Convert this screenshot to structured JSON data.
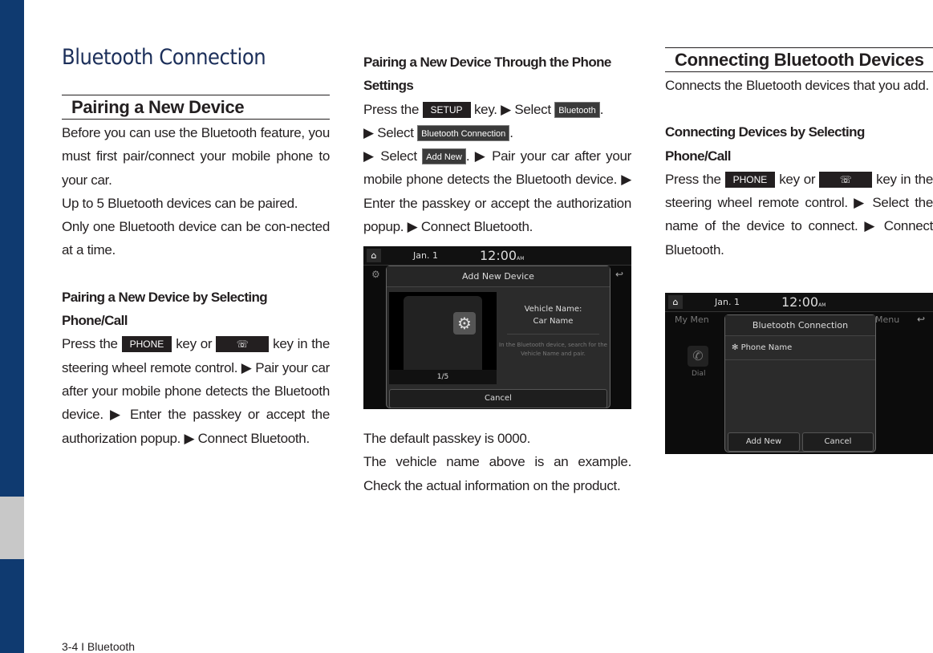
{
  "page_title": "Bluetooth Connection",
  "footer": "3-4 I Bluetooth",
  "colors": {
    "sidebar": "#0f3a70",
    "sidebar_tab": "#c8c8c8",
    "title": "#1c2f5a"
  },
  "col1": {
    "section": "Pairing a New Device",
    "blocks": [
      {
        "p": [
          {
            "t": "Before you can use the Bluetooth feature, you must first pair/connect your mobile phone to your car."
          }
        ]
      },
      {
        "p": [
          {
            "t": "Up to 5 Bluetooth devices can be paired."
          }
        ]
      },
      {
        "p": [
          {
            "t": "Only one Bluetooth device can be con-nected at a time."
          }
        ]
      },
      {
        "gap": true
      },
      {
        "sub": "Pairing a New Device by Selecting Phone/Call"
      },
      {
        "p": [
          {
            "t": "Press the "
          },
          {
            "key": "PHONE"
          },
          {
            "t": " key or "
          },
          {
            "icon": "phone-call-icon"
          },
          {
            "t": " key in the steering wheel remote control. ▶ Pair your car after your mobile phone detects the Bluetooth device. ▶ Enter the passkey or accept the authorization popup. ▶ Connect Bluetooth."
          }
        ]
      }
    ]
  },
  "col2": {
    "blocks": [
      {
        "sub": "Pairing a New Device Through the Phone Settings"
      },
      {
        "p": [
          {
            "t": "Press the "
          },
          {
            "key": "SETUP"
          },
          {
            "t": " key. ▶ Select "
          },
          {
            "gkey": "Bluetooth"
          },
          {
            "t": "."
          }
        ]
      },
      {
        "p": [
          {
            "t": "▶ Select "
          },
          {
            "gkey": "Bluetooth Connection"
          },
          {
            "t": "."
          }
        ]
      },
      {
        "p": [
          {
            "t": "▶ Select "
          },
          {
            "gkey": "Add New"
          },
          {
            "t": ". ▶ Pair your car after your mobile phone detects the Bluetooth device. ▶ Enter the passkey or accept the authorization popup. ▶ Connect Bluetooth."
          }
        ]
      }
    ],
    "screen": {
      "date": "Jan.   1",
      "time": "12:00",
      "ampm": "AM",
      "popup_title": "Add New Device",
      "vehicle_label": "Vehicle Name:",
      "vehicle_name": "Car Name",
      "hint": "In the Bluetooth device, search for the Vehicle Name and pair.",
      "page": "1/5",
      "cancel": "Cancel"
    },
    "after": [
      {
        "p": [
          {
            "t": "The default passkey is 0000."
          }
        ]
      },
      {
        "p": [
          {
            "t": "The vehicle name above is an example. Check the actual information on the product."
          }
        ]
      }
    ]
  },
  "col3": {
    "section": "Connecting Bluetooth Devices",
    "blocks": [
      {
        "p": [
          {
            "t": "Connects the Bluetooth devices that you add."
          }
        ]
      },
      {
        "gap": true
      },
      {
        "sub": "Connecting Devices by Selecting Phone/Call"
      },
      {
        "p": [
          {
            "t": "Press the "
          },
          {
            "key": "PHONE"
          },
          {
            "t": " key or "
          },
          {
            "icon": "phone-call-icon"
          },
          {
            "t": " key  in the steering wheel remote control. ▶ Select the name of the device to connect. ▶ Connect Bluetooth."
          }
        ]
      }
    ],
    "screen": {
      "date": "Jan.   1",
      "time": "12:00",
      "ampm": "AM",
      "bg_left": "My Men",
      "bg_right": "Menu",
      "dial": "Dial",
      "popup_title": "Bluetooth Connection",
      "device": "Phone Name",
      "add_new": "Add New",
      "cancel": "Cancel"
    }
  }
}
